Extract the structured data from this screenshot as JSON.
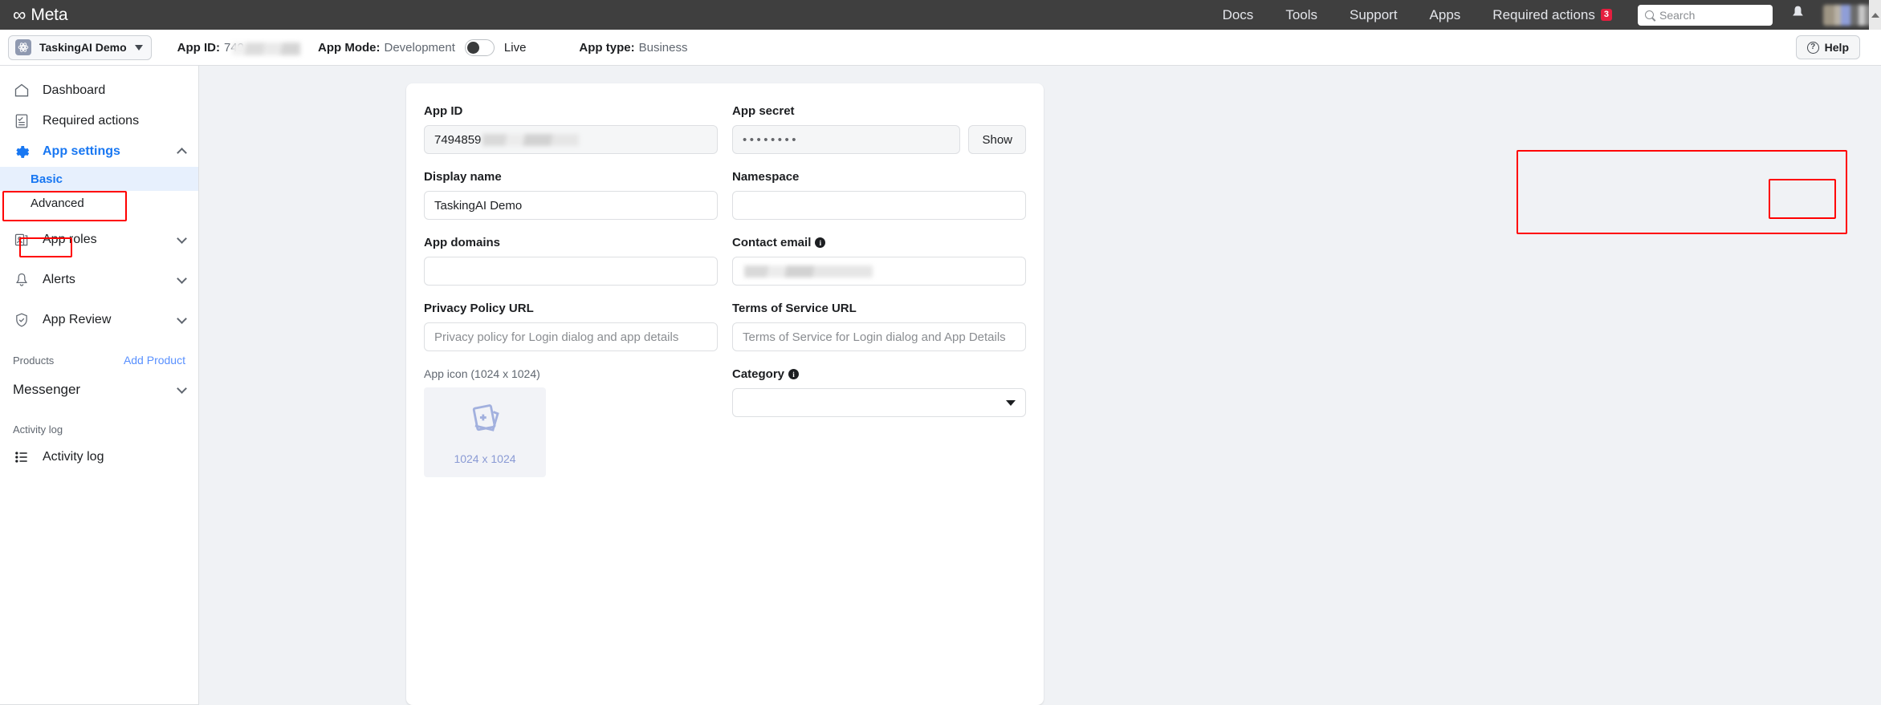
{
  "topbar": {
    "brand": "Meta",
    "brand_glyph": "∞",
    "nav": [
      {
        "label": "Docs"
      },
      {
        "label": "Tools"
      },
      {
        "label": "Support"
      },
      {
        "label": "Apps"
      },
      {
        "label": "Required actions",
        "badge": "3"
      }
    ],
    "search_placeholder": "Search",
    "bell_glyph": "🔔"
  },
  "toolbar": {
    "app_name": "TaskingAI Demo",
    "app_icon_glyph": "⚛",
    "app_id_label": "App ID:",
    "app_id_value": "749",
    "app_mode_label": "App Mode:",
    "app_mode_value": "Development",
    "live_label": "Live",
    "app_type_label": "App type:",
    "app_type_value": "Business",
    "help_label": "Help",
    "help_glyph": "?"
  },
  "sidebar": {
    "items": [
      {
        "label": "Dashboard",
        "icon": "home-icon"
      },
      {
        "label": "Required actions",
        "icon": "checklist-icon"
      },
      {
        "label": "App settings",
        "icon": "gear-icon"
      },
      {
        "label": "App roles",
        "icon": "roles-icon"
      },
      {
        "label": "Alerts",
        "icon": "bell-icon"
      },
      {
        "label": "App Review",
        "icon": "shield-check-icon"
      }
    ],
    "sub_items": [
      {
        "label": "Basic"
      },
      {
        "label": "Advanced"
      }
    ],
    "products_label": "Products",
    "add_product_label": "Add Product",
    "messenger_label": "Messenger",
    "activity_section_label": "Activity log",
    "activity_item_label": "Activity log"
  },
  "form": {
    "app_id": {
      "label": "App ID",
      "value": "7494859"
    },
    "app_secret": {
      "label": "App secret",
      "value": "••••••••",
      "show_label": "Show"
    },
    "display_name": {
      "label": "Display name",
      "value": "TaskingAI Demo"
    },
    "namespace": {
      "label": "Namespace",
      "value": ""
    },
    "app_domains": {
      "label": "App domains",
      "value": ""
    },
    "contact_email": {
      "label": "Contact email",
      "value": "",
      "info": "i"
    },
    "privacy_policy": {
      "label": "Privacy Policy URL",
      "placeholder": "Privacy policy for Login dialog and app details"
    },
    "terms_of_service": {
      "label": "Terms of Service URL",
      "placeholder": "Terms of Service for Login dialog and App Details"
    },
    "app_icon": {
      "label": "App icon (1024 x 1024)",
      "size_text": "1024 x 1024"
    },
    "category": {
      "label": "Category",
      "value": "",
      "info": "i"
    }
  },
  "colors": {
    "annotation_red": "#ff0000",
    "brand_blue": "#1877f2",
    "topbar_dark": "#3f3f3f"
  }
}
